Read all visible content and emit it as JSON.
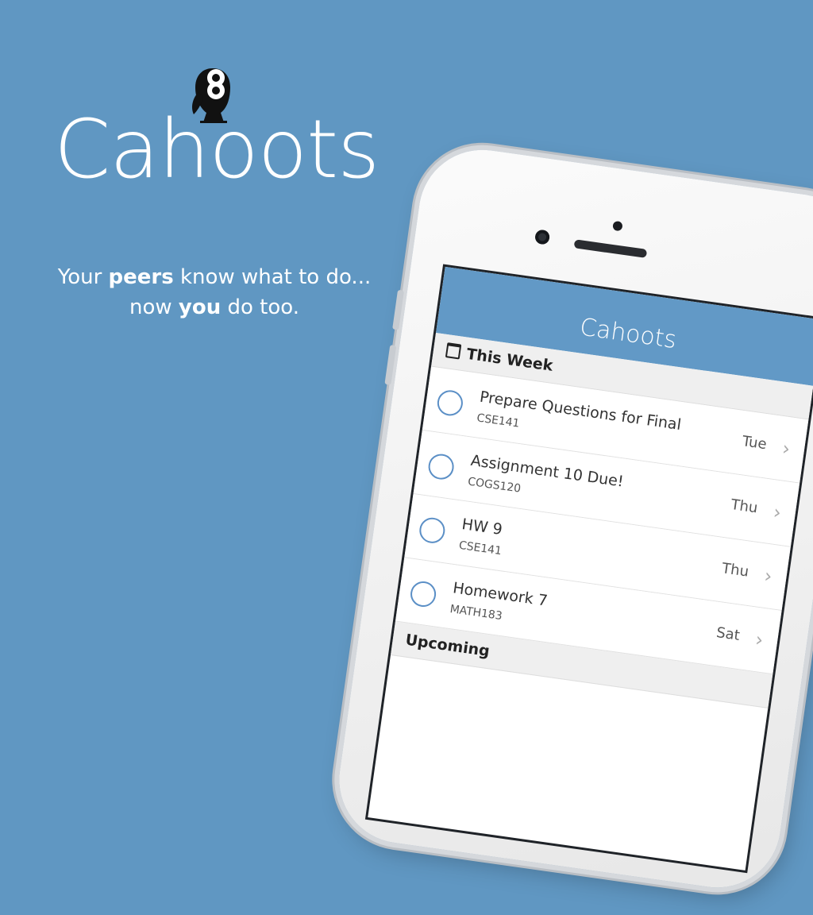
{
  "brand": {
    "name": "Cahoots",
    "tagline_line1_pre": "Your ",
    "tagline_line1_bold": "peers",
    "tagline_line1_post": " know what to do...",
    "tagline_line2_pre": "now ",
    "tagline_line2_bold": "you",
    "tagline_line2_post": " do too.",
    "background_color": "#6097c2"
  },
  "app": {
    "title": "Cahoots",
    "header_color": "#6299c6",
    "sections": [
      {
        "label": "This Week",
        "icon": "calendar-icon",
        "tasks": [
          {
            "title": "Prepare Questions for Final",
            "course": "CSE141",
            "day": "Tue"
          },
          {
            "title": "Assignment 10 Due!",
            "course": "COGS120",
            "day": "Thu"
          },
          {
            "title": "HW 9",
            "course": "CSE141",
            "day": "Thu"
          },
          {
            "title": "Homework 7",
            "course": "MATH183",
            "day": "Sat"
          }
        ]
      },
      {
        "label": "Upcoming"
      }
    ]
  }
}
